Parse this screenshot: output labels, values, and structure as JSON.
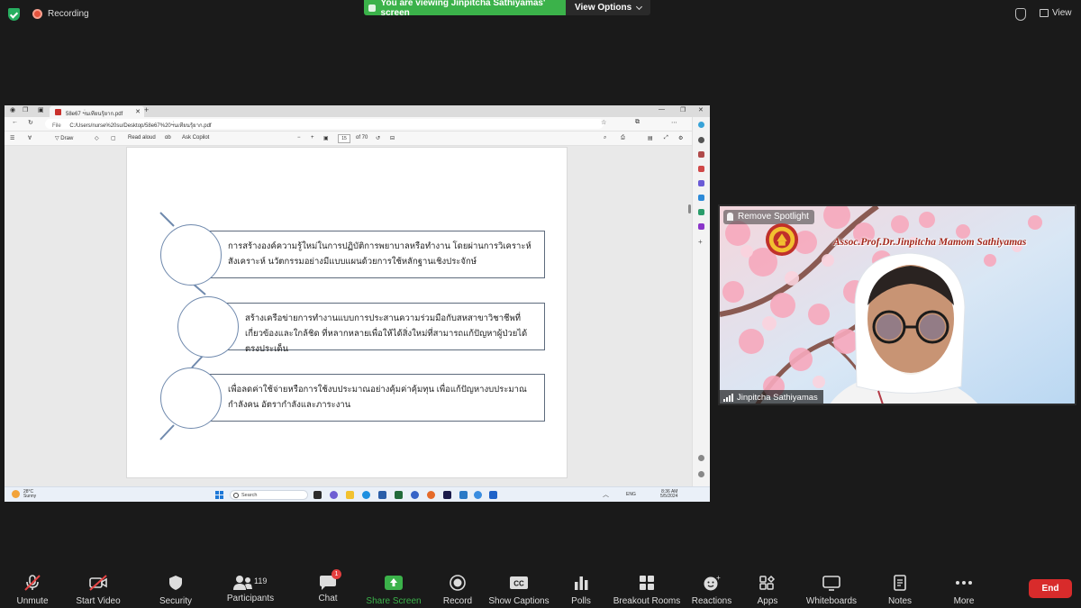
{
  "top_bar": {
    "recording_label": "Recording",
    "viewing_banner": "You are viewing Jinpitcha Sathiyamas' screen",
    "view_options_label": "View Options",
    "view_label": "View"
  },
  "browser": {
    "tab_title": "58e67 ฯ่นเทียนรุ้ยาก.pdf",
    "address_prefix": "File",
    "address": "C:/Users/nurse%20su/Desktop/58e67%20ฯ่นเทียนรุ้ยาก.pdf",
    "toolbar": {
      "draw_label": "Draw",
      "read_aloud_label": "Read aloud",
      "ask_copilot_label": "Ask Copilot",
      "page_current": "15",
      "page_total": "of 70"
    },
    "taskbar": {
      "weather_temp": "28°C",
      "weather_desc": "Sunny",
      "search_placeholder": "Search",
      "lang": "ENG",
      "time": "8:36 AM",
      "date": "5/5/2024"
    }
  },
  "slide": {
    "items": [
      {
        "text": "การสร้างองค์ความรู้ใหม่ในการปฏิบัติการพยาบาลหรือทำงาน โดยผ่านการวิเคราะห์ สังเคราะห์ นวัตกรรมอย่างมีแบบแผนด้วยการใช้หลักฐานเชิงประจักษ์"
      },
      {
        "text": "สร้างเครือข่ายการทำงานแบบการประสานความร่วมมือกับสหสาขาวิชาชีพที่เกี่ยวข้องและใกล้ชิด ที่หลากหลายเพื่อให้ได้สิ่งใหม่ที่สามารถแก้ปัญหาผู้ป่วยได้ตรงประเด็น"
      },
      {
        "text": "เพื่อลดค่าใช้จ่ายหรือการใช้งบประมาณอย่างคุ้มค่าคุ้มทุน เพื่อแก้ปัญหางบประมาณ กำลังคน อัตรากำลังและภาระงาน"
      }
    ]
  },
  "video": {
    "remove_spotlight_label": "Remove Spotlight",
    "overlay_title": "Assoc.Prof.Dr.Jinpitcha Mamom Sathiyamas",
    "participant_name": "Jinpitcha Sathiyamas"
  },
  "toolbar": {
    "unmute": "Unmute",
    "start_video": "Start Video",
    "security": "Security",
    "participants": "Participants",
    "participants_count": "119",
    "chat": "Chat",
    "chat_badge": "1",
    "share_screen": "Share Screen",
    "record": "Record",
    "show_captions": "Show Captions",
    "polls": "Polls",
    "breakout_rooms": "Breakout Rooms",
    "reactions": "Reactions",
    "apps": "Apps",
    "whiteboards": "Whiteboards",
    "notes": "Notes",
    "more": "More",
    "end": "End"
  },
  "colors": {
    "share_green": "#3bb24a",
    "end_red": "#d82b2b",
    "badge_red": "#e43f3f",
    "background": "#1a1a1a"
  }
}
